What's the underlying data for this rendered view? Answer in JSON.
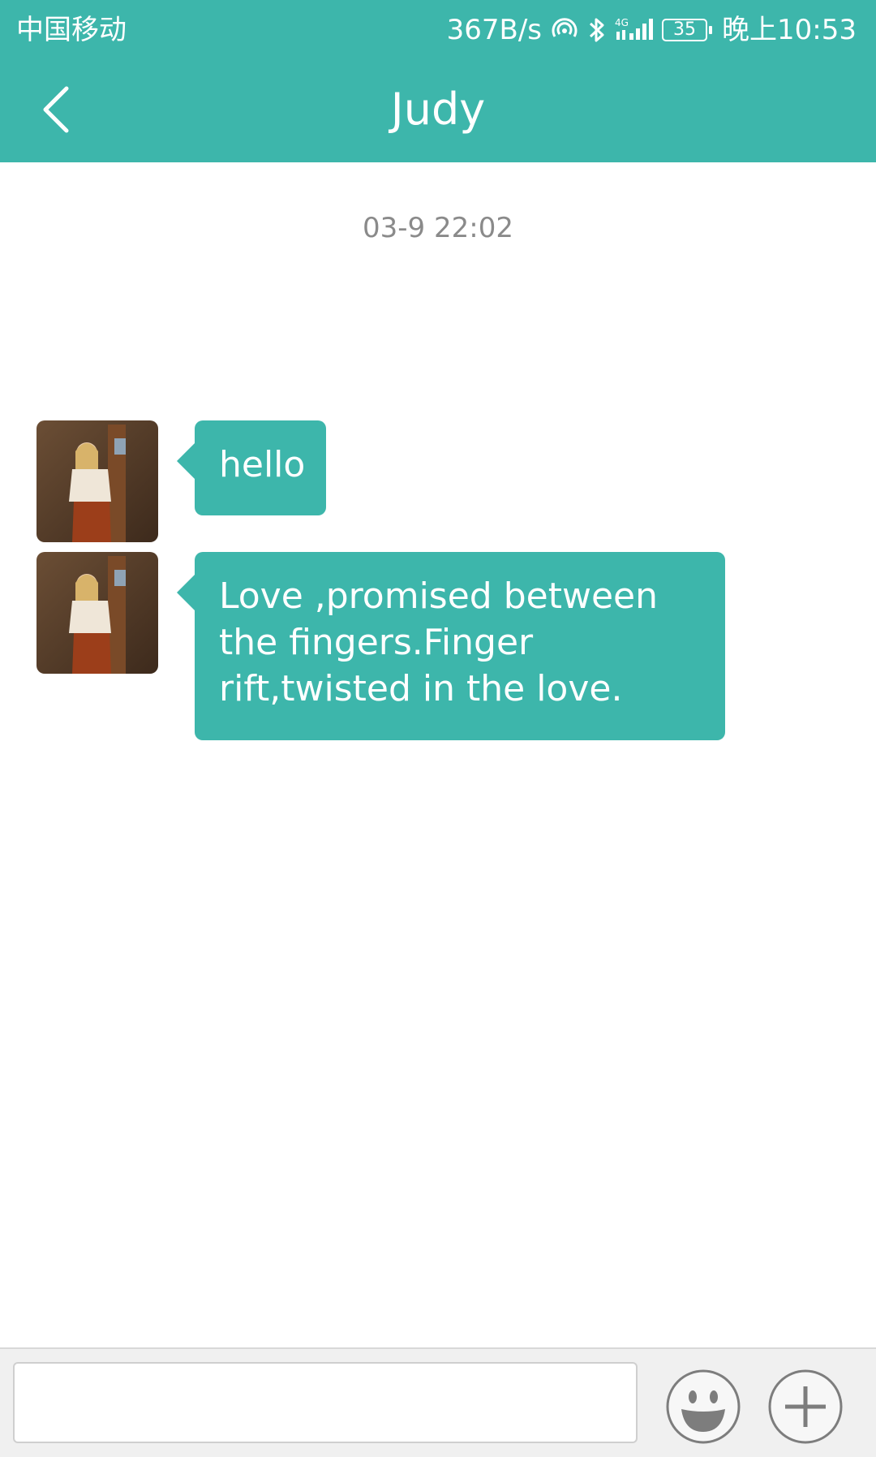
{
  "status_bar": {
    "carrier": "中国移动",
    "net_speed": "367B/s",
    "network_type": "4G",
    "battery": "35",
    "time": "晚上10:53",
    "icons": [
      "hotspot-icon",
      "bluetooth-icon",
      "signal-icon",
      "battery-icon"
    ]
  },
  "header": {
    "title": "Judy",
    "back_icon": "chevron-left-icon"
  },
  "chat": {
    "timestamp": "03-9 22:02",
    "messages": [
      {
        "sender": "Judy",
        "text": "hello"
      },
      {
        "sender": "Judy",
        "text": "Love ,promised between the fingers.Finger rift,twisted in the love."
      }
    ]
  },
  "input_bar": {
    "value": "",
    "placeholder": "",
    "emoji_icon": "emoji-icon",
    "plus_icon": "plus-icon"
  },
  "colors": {
    "accent": "#3db6ab",
    "timestamp": "#8a8a8a",
    "input_bar_bg": "#f0f0f0"
  }
}
